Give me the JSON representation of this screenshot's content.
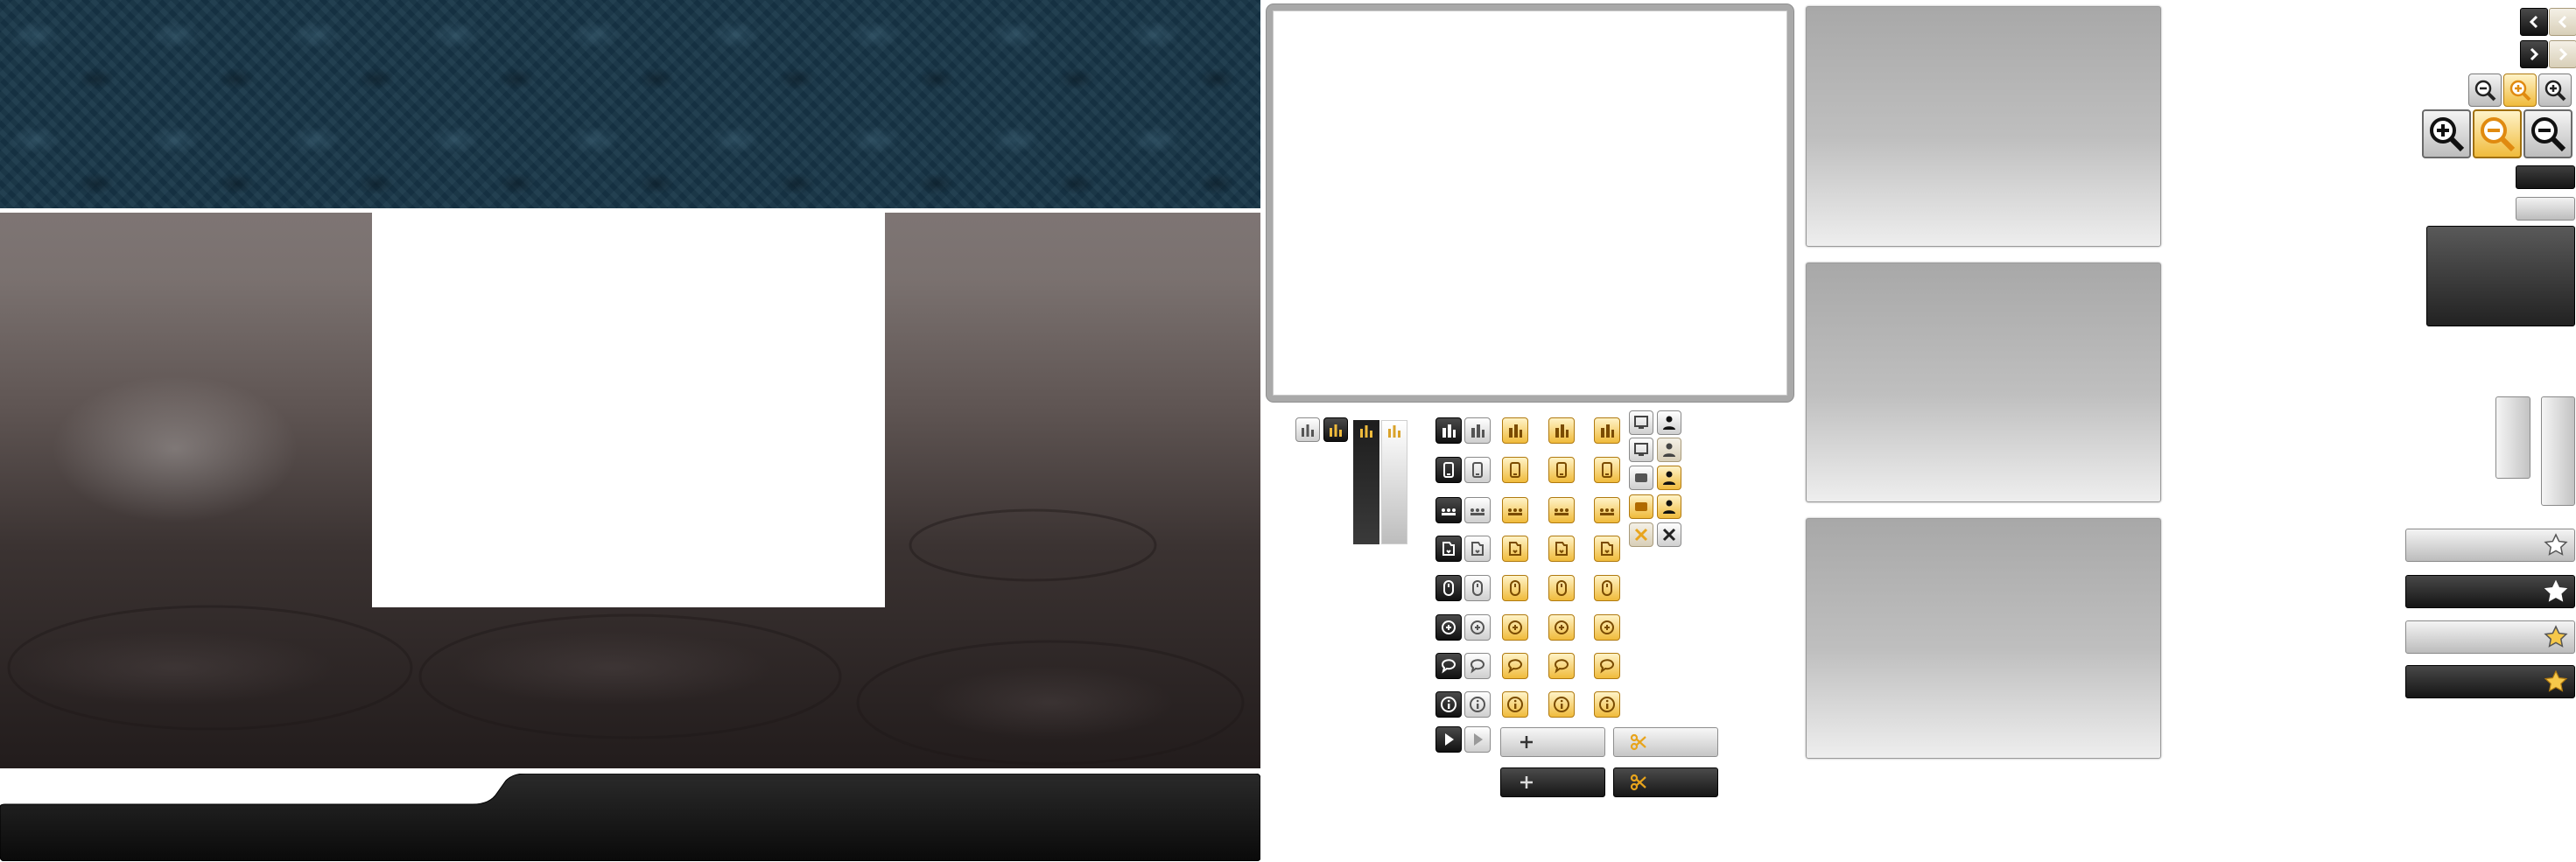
{
  "layout_sheet": {
    "banner": "dark-blue-damask-banner",
    "casino_background": "casino-tables-background",
    "colors": {
      "banner_blue": "#173547",
      "casino_top": "#7e7574",
      "casino_bottom": "#221c1c",
      "bottom_bar": "#0f0f0f",
      "accent_orange": "#f0bb3c",
      "panel_gray": "#bfbfbf"
    }
  },
  "icons": {
    "chart_tiles": [
      "chart-icon",
      "chart-icon-selected",
      "chart-icon-orange"
    ],
    "tool_rows": [
      "bar-chart-icon",
      "phone-icon",
      "grid-icon",
      "bookmark-icon",
      "chip-icon",
      "coin-icon",
      "chat-icon",
      "info-icon",
      "play-icon"
    ],
    "side_tiles": [
      "screen-icon",
      "dealer-icon",
      "table-icon",
      "table-icon-orange",
      "close-icon"
    ],
    "action_buttons": [
      "plus-icon",
      "scissors-icon"
    ],
    "navigation": [
      "chevron-left-icon",
      "chevron-right-icon"
    ],
    "zoom": [
      "zoom-out-icon",
      "zoom-reset-icon",
      "zoom-in-icon"
    ],
    "rating": [
      "star-outline-icon",
      "star-filled-icon",
      "star-gold-outline-icon",
      "star-gold-filled-icon"
    ]
  }
}
